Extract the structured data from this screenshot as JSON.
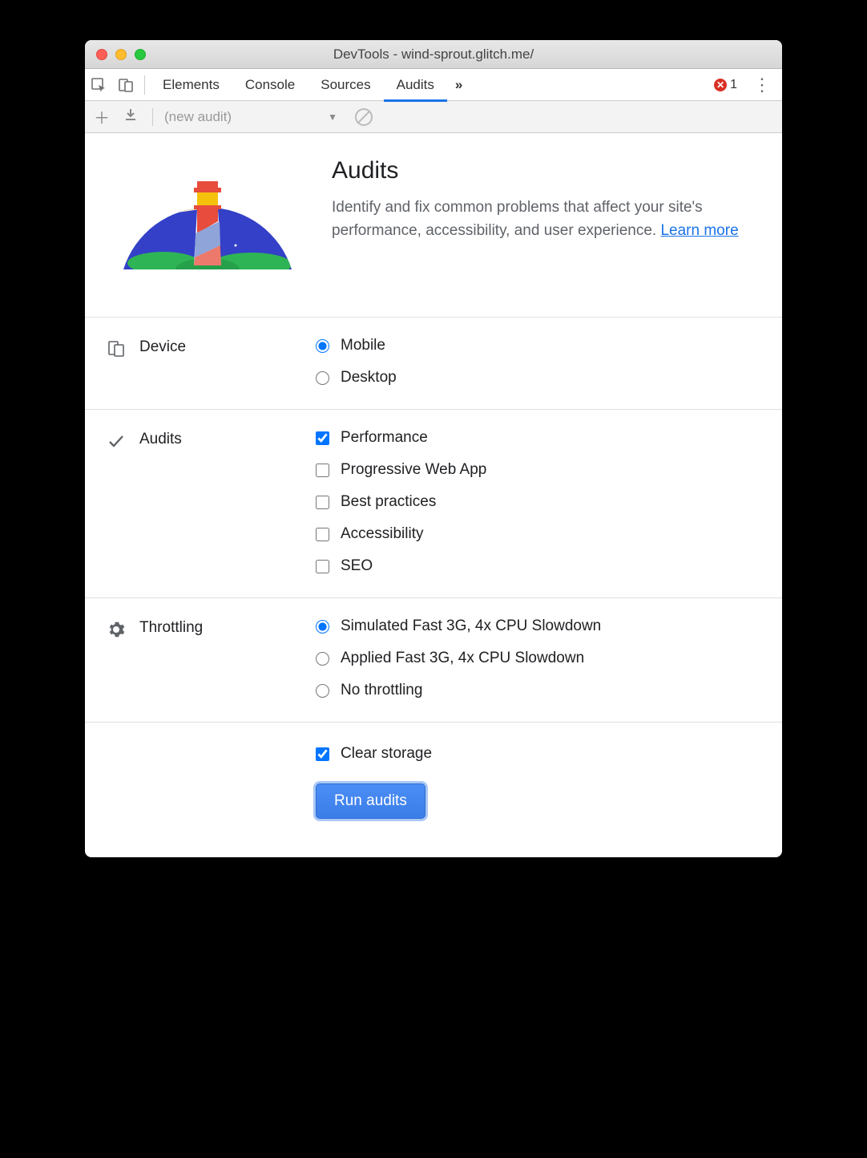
{
  "window": {
    "title": "DevTools - wind-sprout.glitch.me/"
  },
  "tabs": {
    "items": [
      "Elements",
      "Console",
      "Sources",
      "Audits"
    ],
    "active": "Audits",
    "overflow_glyph": "»",
    "error_count": "1"
  },
  "toolbar": {
    "new_audit_label": "(new audit)"
  },
  "hero": {
    "title": "Audits",
    "description_prefix": "Identify and fix common problems that affect your site's performance, accessibility, and user experience. ",
    "learn_more": "Learn more"
  },
  "sections": {
    "device": {
      "label": "Device",
      "options": [
        {
          "label": "Mobile",
          "checked": true
        },
        {
          "label": "Desktop",
          "checked": false
        }
      ]
    },
    "audits": {
      "label": "Audits",
      "options": [
        {
          "label": "Performance",
          "checked": true
        },
        {
          "label": "Progressive Web App",
          "checked": false
        },
        {
          "label": "Best practices",
          "checked": false
        },
        {
          "label": "Accessibility",
          "checked": false
        },
        {
          "label": "SEO",
          "checked": false
        }
      ]
    },
    "throttling": {
      "label": "Throttling",
      "options": [
        {
          "label": "Simulated Fast 3G, 4x CPU Slowdown",
          "checked": true
        },
        {
          "label": "Applied Fast 3G, 4x CPU Slowdown",
          "checked": false
        },
        {
          "label": "No throttling",
          "checked": false
        }
      ]
    }
  },
  "footer": {
    "clear_storage": {
      "label": "Clear storage",
      "checked": true
    },
    "run_button": "Run audits"
  }
}
